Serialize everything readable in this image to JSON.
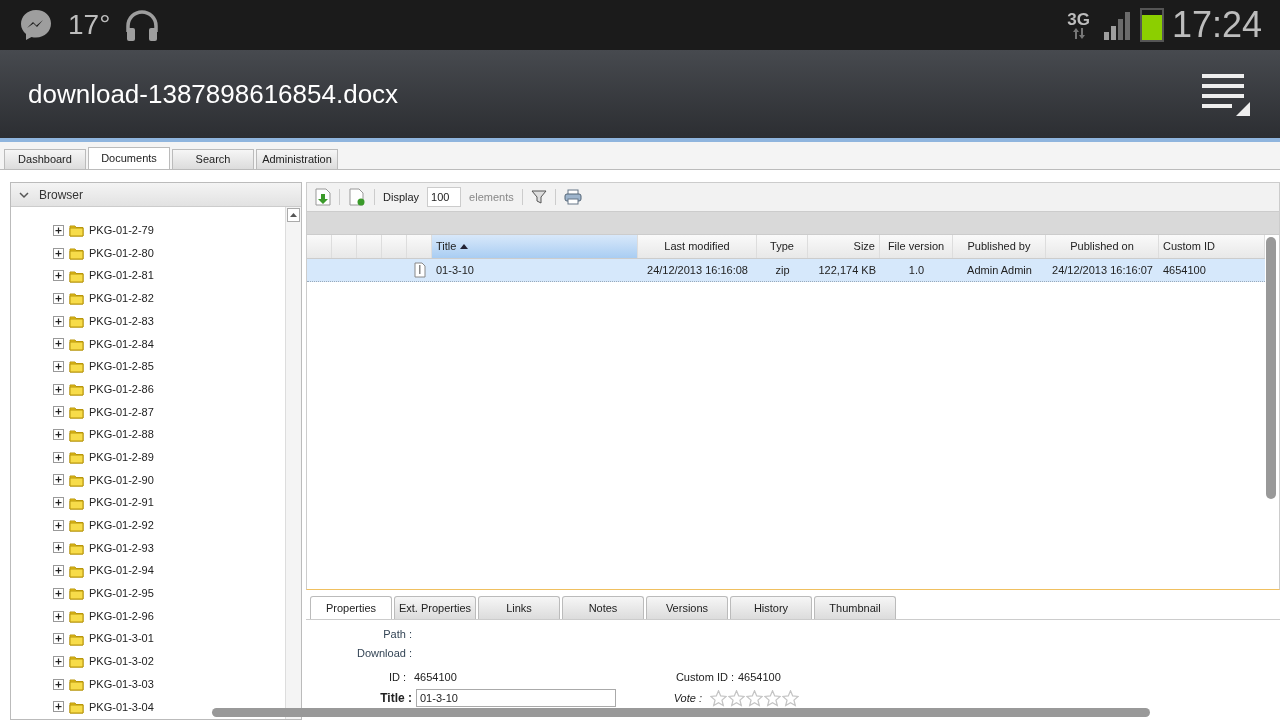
{
  "status_bar": {
    "temperature": "17°",
    "network": "3G",
    "battery": {
      "level": 0.85
    },
    "time": "17:24"
  },
  "app_bar": {
    "title": "download-1387898616854.docx"
  },
  "tabs": [
    {
      "label": "Dashboard",
      "selected": false
    },
    {
      "label": "Documents",
      "selected": true
    },
    {
      "label": "Search",
      "selected": false
    },
    {
      "label": "Administration",
      "selected": false
    }
  ],
  "browser": {
    "title": "Browser",
    "expanded": true,
    "items": [
      {
        "label": "PKG-01-2-79",
        "expanded": false
      },
      {
        "label": "PKG-01-2-80",
        "expanded": false
      },
      {
        "label": "PKG-01-2-81",
        "expanded": false
      },
      {
        "label": "PKG-01-2-82",
        "expanded": false
      },
      {
        "label": "PKG-01-2-83",
        "expanded": false
      },
      {
        "label": "PKG-01-2-84",
        "expanded": false
      },
      {
        "label": "PKG-01-2-85",
        "expanded": false
      },
      {
        "label": "PKG-01-2-86",
        "expanded": false
      },
      {
        "label": "PKG-01-2-87",
        "expanded": false
      },
      {
        "label": "PKG-01-2-88",
        "expanded": false
      },
      {
        "label": "PKG-01-2-89",
        "expanded": false
      },
      {
        "label": "PKG-01-2-90",
        "expanded": false
      },
      {
        "label": "PKG-01-2-91",
        "expanded": false
      },
      {
        "label": "PKG-01-2-92",
        "expanded": false
      },
      {
        "label": "PKG-01-2-93",
        "expanded": false
      },
      {
        "label": "PKG-01-2-94",
        "expanded": false
      },
      {
        "label": "PKG-01-2-95",
        "expanded": false
      },
      {
        "label": "PKG-01-2-96",
        "expanded": false
      },
      {
        "label": "PKG-01-3-01",
        "expanded": false
      },
      {
        "label": "PKG-01-3-02",
        "expanded": false
      },
      {
        "label": "PKG-01-3-03",
        "expanded": false
      },
      {
        "label": "PKG-01-3-04",
        "expanded": false
      }
    ]
  },
  "toolbar": {
    "display_label": "Display",
    "display_value": "100",
    "elements_label": "elements"
  },
  "table": {
    "columns": [
      {
        "label": "Title",
        "sorted": true
      },
      {
        "label": "Last modified",
        "sorted": false
      },
      {
        "label": "Type",
        "sorted": false
      },
      {
        "label": "Size",
        "sorted": false
      },
      {
        "label": "File version",
        "sorted": false
      },
      {
        "label": "Published by",
        "sorted": false
      },
      {
        "label": "Published on",
        "sorted": false
      },
      {
        "label": "Custom ID",
        "sorted": false
      }
    ],
    "rows": [
      {
        "selected": true,
        "cells": [
          "01-3-10",
          "24/12/2013 16:16:08",
          "zip",
          "122,174 KB",
          "1.0",
          "Admin Admin",
          "24/12/2013 16:16:07",
          "4654100"
        ]
      }
    ]
  },
  "detail_tabs": [
    {
      "label": "Properties",
      "selected": true
    },
    {
      "label": "Ext. Properties",
      "selected": false
    },
    {
      "label": "Links",
      "selected": false
    },
    {
      "label": "Notes",
      "selected": false
    },
    {
      "label": "Versions",
      "selected": false
    },
    {
      "label": "History",
      "selected": false
    },
    {
      "label": "Thumbnail",
      "selected": false
    }
  ],
  "properties": {
    "path_label": "Path :",
    "download_label": "Download :",
    "id_label": "ID :",
    "id_value": "4654100",
    "custom_id_label": "Custom ID :",
    "custom_id_value": "4654100",
    "title_label": "Title :",
    "title_value": "01-3-10",
    "vote_label": "Vote :",
    "stars": 0
  }
}
